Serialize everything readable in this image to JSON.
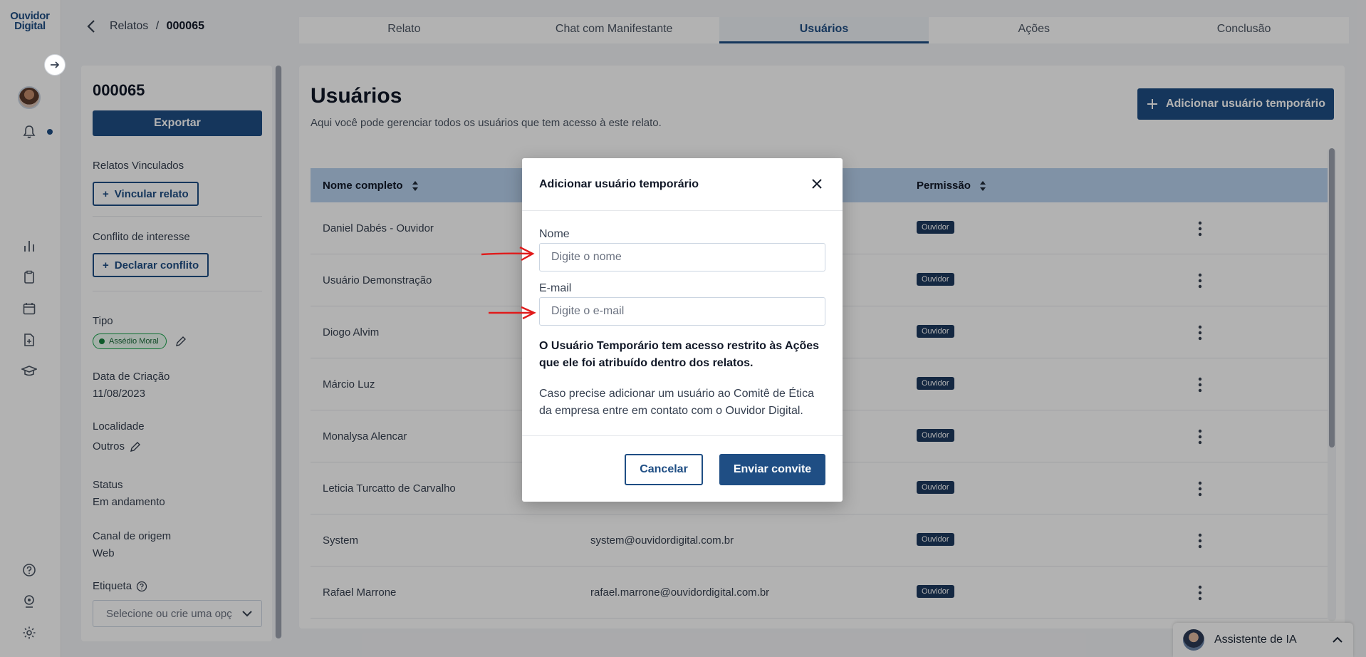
{
  "app": {
    "logo_line1": "Ouvidor",
    "logo_line2": "Digital"
  },
  "header": {
    "breadcrumb_parent": "Relatos",
    "breadcrumb_sep": "/",
    "breadcrumb_current": "000065",
    "tabs": [
      {
        "label": "Relato"
      },
      {
        "label": "Chat com Manifestante"
      },
      {
        "label": "Usuários",
        "active": true
      },
      {
        "label": "Ações"
      },
      {
        "label": "Conclusão"
      }
    ]
  },
  "side": {
    "case_id": "000065",
    "export_label": "Exportar",
    "linked_label": "Relatos Vinculados",
    "link_button": "Vincular relato",
    "conflict_label": "Conflito de interesse",
    "conflict_button": "Declarar conflito",
    "type_label": "Tipo",
    "type_value": "Assédio Moral",
    "created_label": "Data de Criação",
    "created_value": "11/08/2023",
    "locality_label": "Localidade",
    "locality_value": "Outros",
    "status_label": "Status",
    "status_value": "Em andamento",
    "channel_label": "Canal de origem",
    "channel_value": "Web",
    "tag_label": "Etiqueta",
    "tag_placeholder": "Selecione ou crie uma opç"
  },
  "main": {
    "title": "Usuários",
    "subtitle": "Aqui você pode gerenciar todos os usuários que tem acesso à este relato.",
    "add_button": "Adicionar usuário temporário",
    "columns": {
      "name": "Nome completo",
      "permission": "Permissão"
    },
    "rows": [
      {
        "name": "Daniel Dabés - Ouvidor",
        "email": "",
        "permission": "Ouvidor"
      },
      {
        "name": "Usuário Demonstração",
        "email": "",
        "permission": "Ouvidor"
      },
      {
        "name": "Diogo Alvim",
        "email": "",
        "permission": "Ouvidor"
      },
      {
        "name": "Márcio Luz",
        "email": "",
        "permission": "Ouvidor"
      },
      {
        "name": "Monalysa Alencar",
        "email": "",
        "permission": "Ouvidor"
      },
      {
        "name": "Leticia Turcatto de Carvalho",
        "email": "",
        "permission": "Ouvidor"
      },
      {
        "name": "System",
        "email": "system@ouvidordigital.com.br",
        "permission": "Ouvidor"
      },
      {
        "name": "Rafael Marrone",
        "email": "rafael.marrone@ouvidordigital.com.br",
        "permission": "Ouvidor"
      }
    ]
  },
  "modal": {
    "title": "Adicionar usuário temporário",
    "name_label": "Nome",
    "name_placeholder": "Digite o nome",
    "email_label": "E-mail",
    "email_placeholder": "Digite o e-mail",
    "note": "O Usuário Temporário tem acesso restrito às Ações que ele foi atribuído dentro dos relatos.",
    "info": "Caso precise adicionar um usuário ao Comitê de Ética da empresa entre em contato com o Ouvidor Digital.",
    "cancel": "Cancelar",
    "send": "Enviar convite"
  },
  "chat": {
    "label": "Assistente de IA"
  },
  "colors": {
    "primary": "#1f4e84",
    "header_row": "#b8d2ee",
    "badge": "#1e3a5f",
    "annotation_arrow": "#e01b1b"
  }
}
